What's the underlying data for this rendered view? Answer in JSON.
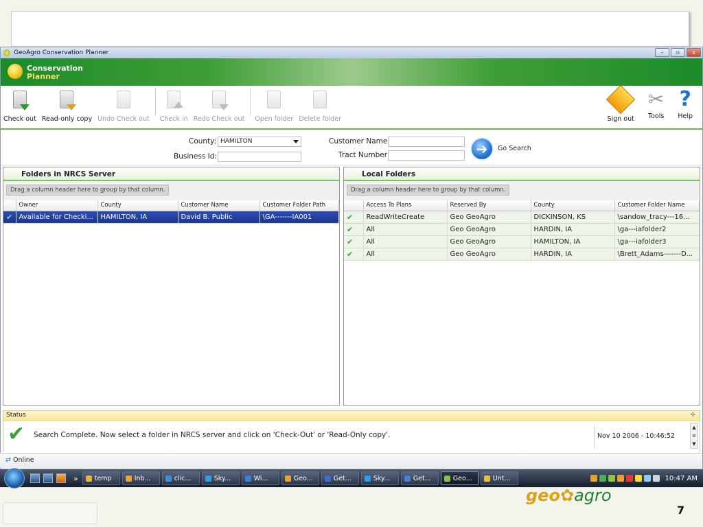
{
  "window": {
    "title": "GeoAgro Conservation Planner",
    "controls": [
      "–",
      "▫",
      "x"
    ]
  },
  "banner": {
    "title": "Conservation",
    "subtitle": "Planner"
  },
  "toolbar": {
    "check_out": "Check out",
    "read_only_copy": "Read-only copy",
    "undo_check_out": "Undo Check out",
    "check_in": "Check in",
    "redo_check_out": "Redo Check out",
    "open_folder": "Open folder",
    "delete_folder": "Delete folder",
    "sign_out": "Sign out",
    "tools": "Tools",
    "help": "Help"
  },
  "search": {
    "county_label": "County:",
    "county_value": "HAMILTON",
    "business_id_label": "Business Id:",
    "business_id_value": "",
    "customer_name_label": "Customer Name:",
    "customer_name_value": "",
    "tract_number_label": "Tract Number:",
    "tract_number_value": "",
    "go_label": "Go Search"
  },
  "nrcs_panel": {
    "title": "Folders in NRCS Server",
    "group_hint": "Drag a column header here to group by that column.",
    "columns": [
      "Owner",
      "County",
      "Customer Name",
      "Customer Folder Path"
    ],
    "rows": [
      [
        "Available for Checki...",
        "HAMILTON, IA",
        "David B. Public",
        "\\GA-------IA001"
      ]
    ]
  },
  "local_panel": {
    "title": "Local Folders",
    "group_hint": "Drag a column header here to group by that column.",
    "columns": [
      "Access To Plans",
      "Reserved By",
      "County",
      "Customer Folder Name"
    ],
    "rows": [
      [
        "ReadWriteCreate",
        "Geo GeoAgro",
        "DICKINSON, KS",
        "\\sandow_tracy---16..."
      ],
      [
        "All",
        "Geo GeoAgro",
        "HARDIN, IA",
        "\\ga---iafolder2"
      ],
      [
        "All",
        "Geo GeoAgro",
        "HAMILTON, IA",
        "\\ga---iafolder3"
      ],
      [
        "All",
        "Geo GeoAgro",
        "HARDIN, IA",
        "\\Brett_Adams-------D..."
      ]
    ]
  },
  "status": {
    "title": "Status",
    "message": "Search Complete. Now select a folder in NRCS server and click on 'Check-Out' or 'Read-Only copy'.",
    "timestamp": "Nov 10 2006 - 10:46:52"
  },
  "online": {
    "label": "Online"
  },
  "taskbar": {
    "items": [
      {
        "label": "temp",
        "color": "#e6c04a"
      },
      {
        "label": "Inb...",
        "color": "#f0a030"
      },
      {
        "label": "clic...",
        "color": "#3a8ee0"
      },
      {
        "label": "Sky...",
        "color": "#2a9de6"
      },
      {
        "label": "Wi...",
        "color": "#3a7fd6"
      },
      {
        "label": "Geo...",
        "color": "#e8a030"
      },
      {
        "label": "Get...",
        "color": "#3a6fd0"
      },
      {
        "label": "Sky...",
        "color": "#2a9de6"
      },
      {
        "label": "Get...",
        "color": "#4a7fd6"
      },
      {
        "label": "Geo...",
        "color": "#8bc34a"
      },
      {
        "label": "Unt...",
        "color": "#e8c040"
      }
    ],
    "clock": "10:47 AM"
  },
  "footer": {
    "logo_left": "geo",
    "logo_right": "agro",
    "page_number": "7"
  }
}
